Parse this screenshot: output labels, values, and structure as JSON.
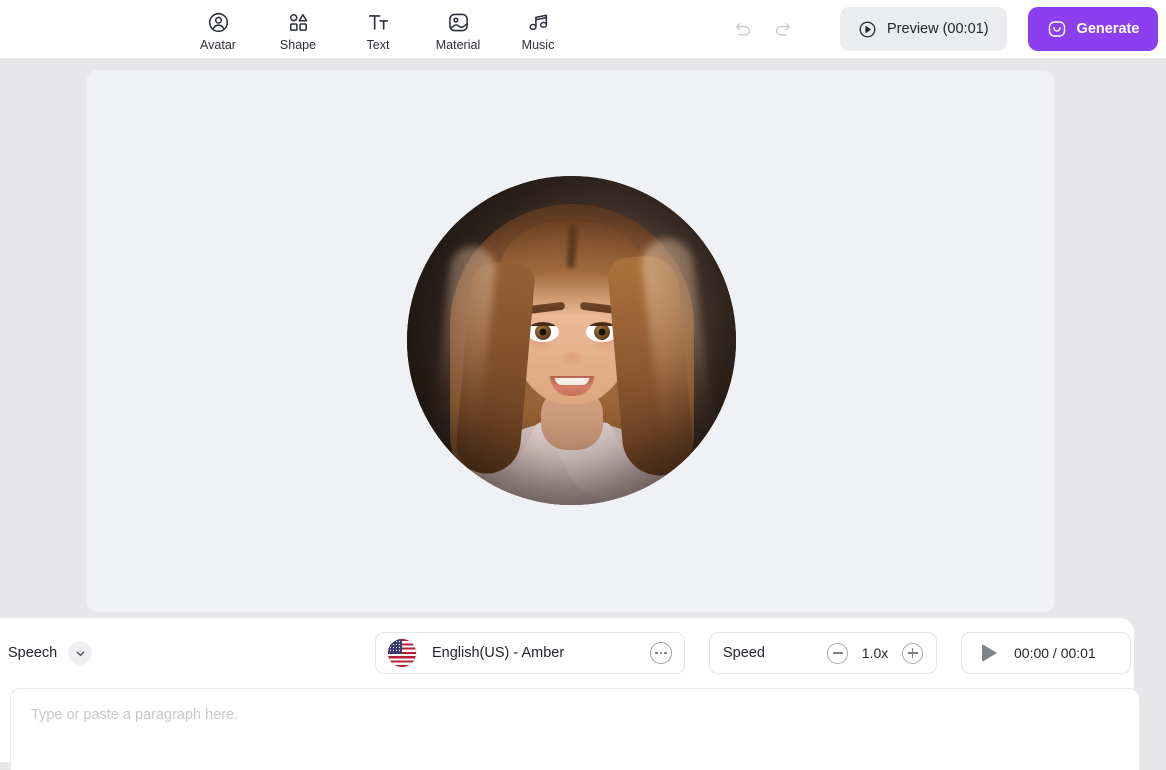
{
  "header": {
    "tools": [
      {
        "label": "Avatar",
        "icon": "avatar-icon"
      },
      {
        "label": "Shape",
        "icon": "shape-icon"
      },
      {
        "label": "Text",
        "icon": "text-icon"
      },
      {
        "label": "Material",
        "icon": "material-image-icon"
      },
      {
        "label": "Music",
        "icon": "music-note-icon"
      }
    ],
    "undo_icon": "undo-arrow-icon",
    "redo_icon": "redo-arrow-icon",
    "preview_label": "Preview (00:01)",
    "preview_icon": "play-circle-icon",
    "generate_label": "Generate",
    "generate_icon": "sparkle-smile-icon",
    "generate_color": "#8b3ff0"
  },
  "canvas": {
    "background_color": "#f0f1f4",
    "avatar_name": "female-3d-avatar"
  },
  "bottom": {
    "speech_label": "Speech",
    "speech_chevron_icon": "chevron-down-icon",
    "voice": {
      "flag_icon": "us-flag-icon",
      "name": "English(US) - Amber",
      "more_icon": "ellipsis-icon"
    },
    "speed": {
      "label": "Speed",
      "value": "1.0x",
      "decrease_icon": "minus-circle-icon",
      "increase_icon": "plus-circle-icon"
    },
    "player": {
      "play_icon": "play-triangle-icon",
      "time": "00:00 / 00:01"
    },
    "script": {
      "value": "",
      "placeholder": "Type or paste a paragraph here."
    }
  }
}
